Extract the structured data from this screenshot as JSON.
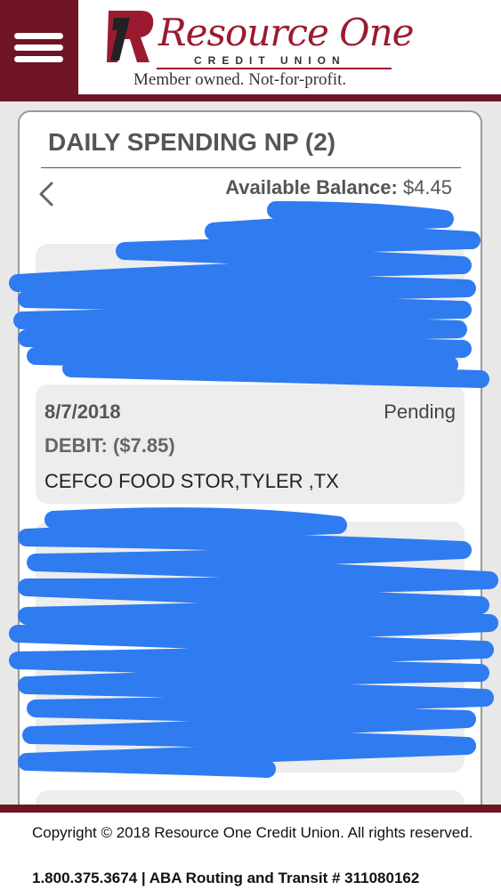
{
  "header": {
    "logo_name": "Resource One",
    "logo_sub": "CREDIT UNION",
    "tagline": "Member owned. Not-for-profit.",
    "brand_color": "#6e1423"
  },
  "account": {
    "title": "DAILY SPENDING NP (2)",
    "balance_label": "Available Balance:",
    "balance_value": "$4.45"
  },
  "transactions": [
    {
      "date": "8/7/2018",
      "status": "Pending",
      "amount": "DEBIT: ($7.85)",
      "description": "CEFCO FOOD STOR,TYLER ,TX"
    }
  ],
  "footer": {
    "copyright": "Copyright © 2018 Resource One Credit Union. All rights reserved.",
    "phone_line": "1.800.375.3674 | ABA Routing and Transit # 311080162"
  },
  "redaction_color": "#2f7bf0"
}
